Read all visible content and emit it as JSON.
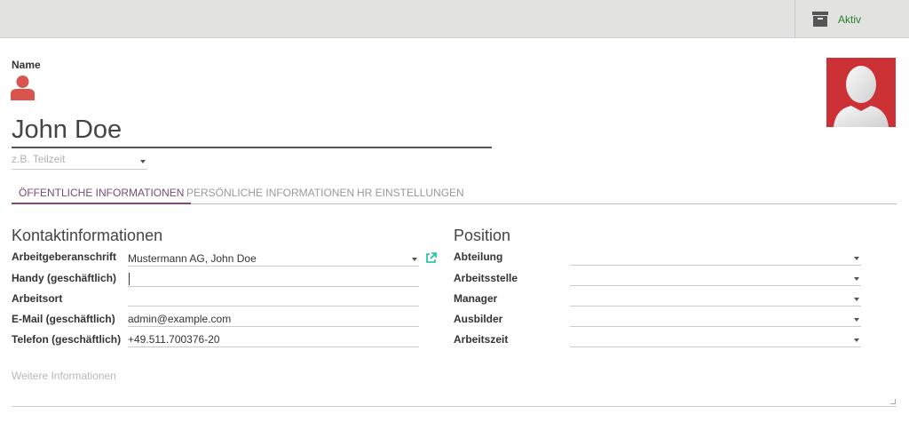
{
  "topbar": {
    "active_label": "Aktiv",
    "archive_icon": "archive-box-icon",
    "active_color": "#2e7d32"
  },
  "employee": {
    "name_label": "Name",
    "name_value": "John Doe",
    "user_icon": "user-icon",
    "user_icon_color": "#d9534f",
    "tags_placeholder": "z.B. Teilzeit",
    "avatar_bg": "#cb3135"
  },
  "tabs": [
    {
      "label": "Öffentliche Informationen",
      "active": true
    },
    {
      "label": "Persönliche Informationen",
      "active": false
    },
    {
      "label": "HR Einstellungen",
      "active": false
    }
  ],
  "contact": {
    "title": "Kontaktinformationen",
    "fields": [
      {
        "label": "Arbeitgeberanschrift",
        "value": "Mustermann AG, John Doe"
      },
      {
        "label": "Handy (geschäftlich)",
        "value": ""
      },
      {
        "label": "Arbeitsort",
        "value": ""
      },
      {
        "label": "E-Mail (geschäftlich)",
        "value": "admin@example.com"
      },
      {
        "label": "Telefon (geschäftlich)",
        "value": "+49.511.700376-20"
      }
    ]
  },
  "position": {
    "title": "Position",
    "fields": [
      {
        "label": "Abteilung",
        "value": ""
      },
      {
        "label": "Arbeitsstelle",
        "value": ""
      },
      {
        "label": "Manager",
        "value": ""
      },
      {
        "label": "Ausbilder",
        "value": ""
      },
      {
        "label": "Arbeitszeit",
        "value": ""
      }
    ]
  },
  "notes": {
    "placeholder": "Weitere Informationen"
  },
  "colors": {
    "tab_active": "#7c4c72",
    "external_link": "#1abc9c"
  }
}
